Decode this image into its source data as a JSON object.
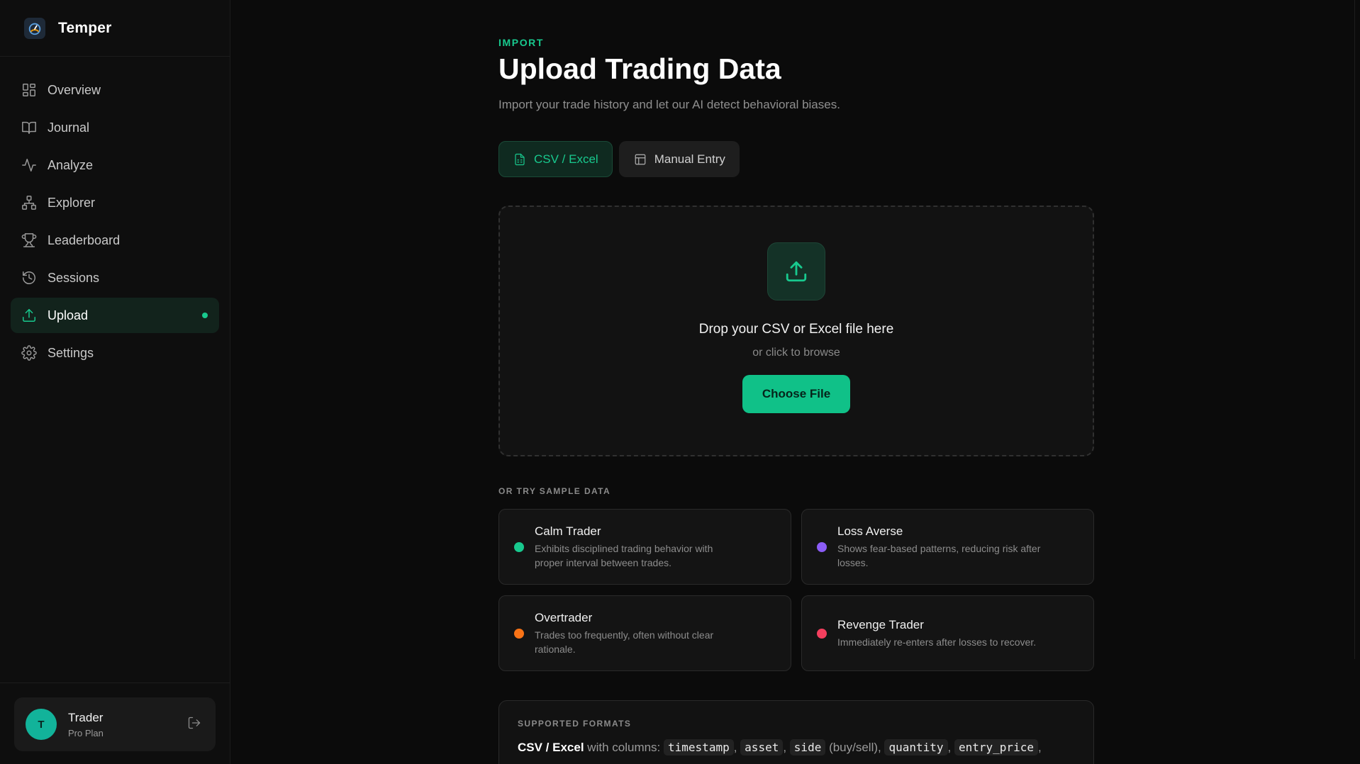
{
  "brand": {
    "name": "Temper",
    "logo_icon": "gauge-icon"
  },
  "nav": {
    "items": [
      {
        "label": "Overview",
        "icon": "grid-icon"
      },
      {
        "label": "Journal",
        "icon": "book-icon"
      },
      {
        "label": "Analyze",
        "icon": "activity-icon"
      },
      {
        "label": "Explorer",
        "icon": "network-icon"
      },
      {
        "label": "Leaderboard",
        "icon": "trophy-icon"
      },
      {
        "label": "Sessions",
        "icon": "history-icon"
      },
      {
        "label": "Upload",
        "icon": "upload-icon",
        "active": true
      },
      {
        "label": "Settings",
        "icon": "gear-icon"
      }
    ]
  },
  "user": {
    "initial": "T",
    "name": "Trader",
    "plan": "Pro Plan"
  },
  "page": {
    "eyebrow": "IMPORT",
    "title": "Upload Trading Data",
    "subtitle": "Import your trade history and let our AI detect behavioral biases."
  },
  "tabs": [
    {
      "label": "CSV / Excel",
      "active": true
    },
    {
      "label": "Manual Entry",
      "active": false
    }
  ],
  "dropzone": {
    "title": "Drop your CSV or Excel file here",
    "subtitle": "or click to browse",
    "button": "Choose File"
  },
  "samples": {
    "label": "OR TRY SAMPLE DATA",
    "items": [
      {
        "name": "Calm Trader",
        "desc": "Exhibits disciplined trading behavior with proper interval between trades.",
        "color": "#18c98e"
      },
      {
        "name": "Loss Averse",
        "desc": "Shows fear-based patterns, reducing risk after losses.",
        "color": "#8b5cf6"
      },
      {
        "name": "Overtrader",
        "desc": "Trades too frequently, often without clear rationale.",
        "color": "#f97316"
      },
      {
        "name": "Revenge Trader",
        "desc": "Immediately re-enters after losses to recover.",
        "color": "#f43f5e"
      }
    ]
  },
  "formats": {
    "label": "SUPPORTED FORMATS",
    "lead": "CSV / Excel",
    "with_columns": "with columns:",
    "columns": [
      "timestamp",
      "asset",
      "side",
      "quantity",
      "entry_price"
    ],
    "side_note": "(buy/sell),"
  },
  "colors": {
    "accent": "#18c98e",
    "background": "#0b0b0b"
  }
}
